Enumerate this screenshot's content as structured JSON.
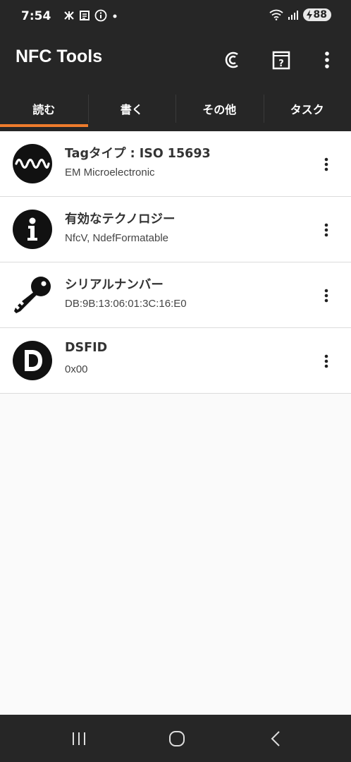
{
  "status": {
    "time": "7:54",
    "battery": "88"
  },
  "app": {
    "title": "NFC Tools"
  },
  "tabs": [
    {
      "label": "読む"
    },
    {
      "label": "書く"
    },
    {
      "label": "その他"
    },
    {
      "label": "タスク"
    }
  ],
  "items": [
    {
      "title": "Tagタイプ : ISO 15693",
      "subtitle": "EM Microelectronic",
      "icon": "wave-icon"
    },
    {
      "title": "有効なテクノロジー",
      "subtitle": "NfcV, NdefFormatable",
      "icon": "info-icon"
    },
    {
      "title": "シリアルナンバー",
      "subtitle": "DB:9B:13:06:01:3C:16:E0",
      "icon": "key-icon"
    },
    {
      "title": "DSFID",
      "subtitle": "0x00",
      "icon": "d-letter-icon"
    }
  ],
  "colors": {
    "bar": "#262626",
    "accent": "#ee7b2c",
    "background": "#fafafa"
  }
}
